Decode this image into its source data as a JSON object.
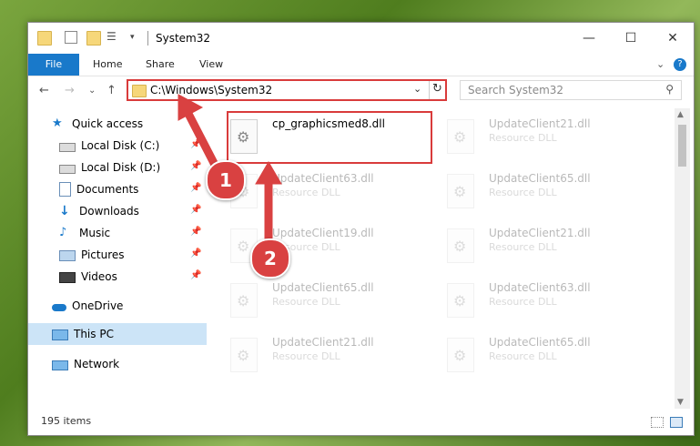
{
  "window": {
    "title": "System32",
    "controls": {
      "minimize": "—",
      "maximize": "☐",
      "close": "✕"
    }
  },
  "ribbon": {
    "tabs": [
      "File",
      "Home",
      "Share",
      "View"
    ],
    "expand": "⌄",
    "help": "?"
  },
  "navigation": {
    "back": "←",
    "forward": "→",
    "recent": "⌄",
    "up": "↑",
    "address": "C:\\Windows\\System32",
    "address_dropdown": "⌄",
    "refresh": "↻",
    "search_placeholder": "Search System32",
    "search_icon": "⚲"
  },
  "sidebar": {
    "items": [
      {
        "label": "Quick access",
        "icon": "star-icon",
        "pinned": false
      },
      {
        "label": "Local Disk (C:)",
        "icon": "drive-icon",
        "pinned": true
      },
      {
        "label": "Local Disk (D:)",
        "icon": "drive-icon",
        "pinned": true
      },
      {
        "label": "Documents",
        "icon": "documents-icon",
        "pinned": true
      },
      {
        "label": "Downloads",
        "icon": "download-icon",
        "pinned": true
      },
      {
        "label": "Music",
        "icon": "music-icon",
        "pinned": true
      },
      {
        "label": "Pictures",
        "icon": "pictures-icon",
        "pinned": true
      },
      {
        "label": "Videos",
        "icon": "video-icon",
        "pinned": true
      },
      {
        "label": "OneDrive",
        "icon": "cloud-icon",
        "pinned": false
      },
      {
        "label": "This PC",
        "icon": "computer-icon",
        "pinned": false,
        "selected": true
      },
      {
        "label": "Network",
        "icon": "network-icon",
        "pinned": false
      }
    ],
    "pin_glyph": "📌"
  },
  "files": [
    {
      "name": "cp_graphicsmed8.dll",
      "type": "",
      "highlighted": true
    },
    {
      "name": "UpdateClient21.dll",
      "type": "Resource DLL"
    },
    {
      "name": "UpdateClient63.dll",
      "type": "Resource DLL"
    },
    {
      "name": "UpdateClient65.dll",
      "type": "Resource DLL"
    },
    {
      "name": "UpdateClient19.dll",
      "type": "Resource DLL"
    },
    {
      "name": "UpdateClient21.dll",
      "type": "Resource DLL"
    },
    {
      "name": "UpdateClient65.dll",
      "type": "Resource DLL"
    },
    {
      "name": "UpdateClient63.dll",
      "type": "Resource DLL"
    },
    {
      "name": "UpdateClient21.dll",
      "type": "Resource DLL"
    },
    {
      "name": "UpdateClient65.dll",
      "type": "Resource DLL"
    }
  ],
  "status": {
    "item_count": "195 items"
  },
  "annotations": {
    "marker_1": "1",
    "marker_2": "2",
    "color": "#d94141"
  }
}
